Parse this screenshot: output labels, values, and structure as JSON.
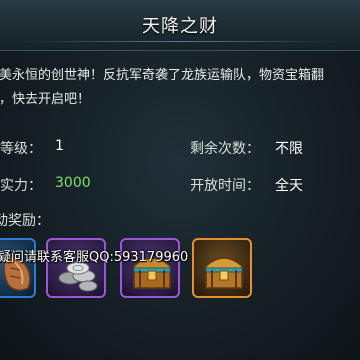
{
  "title": "天降之财",
  "description": {
    "line1": "灵美永恒的创世神！反抗军奇袭了龙族运输队，物资宝箱翻",
    "line2": "卌，快去开启吧！"
  },
  "info": {
    "level_label": "敌等级：",
    "level_value": "1",
    "power_label": "荐实力：",
    "power_value": "3000",
    "remaining_label": "剩余次数：",
    "remaining_value": "不限",
    "open_time_label": "开放时间：",
    "open_time_value": "全天"
  },
  "rewards_label": "动奖励：",
  "rewards": [
    {
      "icon": "bronze-item-icon",
      "rarity": "blue"
    },
    {
      "icon": "silver-coins-icon",
      "rarity": "purple"
    },
    {
      "icon": "treasure-chest-icon",
      "rarity": "purple"
    },
    {
      "icon": "treasure-chest-icon",
      "rarity": "orange"
    }
  ],
  "watermark": "疑问请联系客服QQ:593179960",
  "colors": {
    "accent_green": "#7fe06a",
    "rarity_blue": "#2f7bd2",
    "rarity_purple": "#9a58d8",
    "rarity_orange": "#e1922e"
  }
}
